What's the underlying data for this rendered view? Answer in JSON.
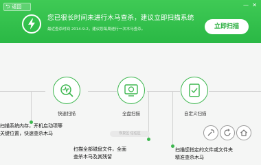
{
  "topbar": {
    "back_label": "返回"
  },
  "banner": {
    "headline": "您已很长时间未进行木马查杀，建议立即扫描系统",
    "subline": "最近查杀时间 2014-9-2，建议您每周进行一次木马查杀。",
    "scan_button": "立即扫描"
  },
  "scan_modes": [
    {
      "label": "快速扫描"
    },
    {
      "label": "全盘扫描"
    },
    {
      "label": "自定义扫描"
    }
  ],
  "callouts": {
    "quick": [
      "扫描系统内存，开机启动项等",
      "关键位置，快速查杀木马"
    ],
    "full": [
      "扫描全部磁盘文件，全面",
      "查杀木马及其残留"
    ],
    "custom": [
      "扫描您指定的文件或文件夹",
      "精准查杀木马"
    ]
  },
  "footer": {
    "faint_text": "恢复区  信任区"
  },
  "colors": {
    "accent": "#2ab845",
    "circle_stroke": "#3db74f"
  }
}
